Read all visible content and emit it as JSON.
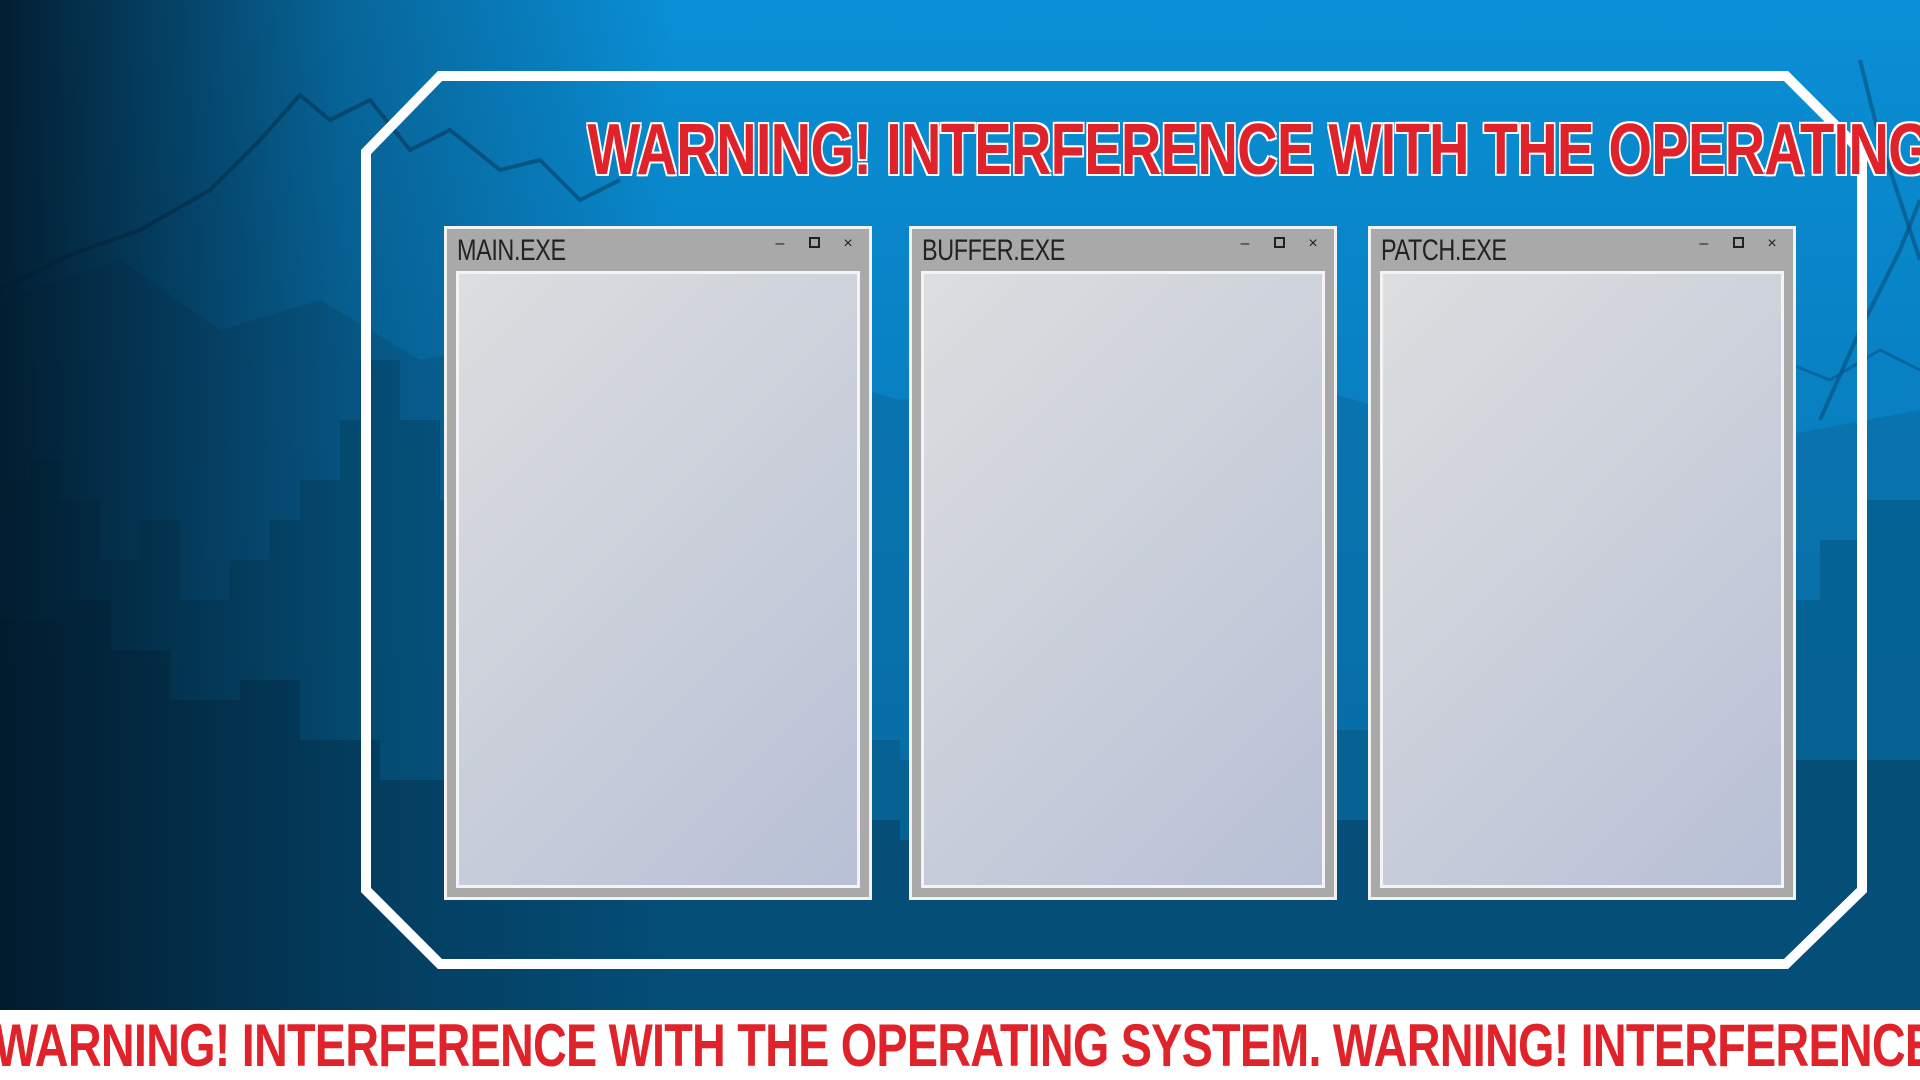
{
  "headline": "WARNING! INTERFERENCE WITH THE OPERATING SYSTEM",
  "windows": [
    {
      "title": "MAIN.EXE",
      "controls": {
        "minimize": "–",
        "maximize": "□",
        "close": "×"
      }
    },
    {
      "title": "BUFFER.EXE",
      "controls": {
        "minimize": "–",
        "maximize": "□",
        "close": "×"
      }
    },
    {
      "title": "PATCH.EXE",
      "controls": {
        "minimize": "–",
        "maximize": "□",
        "close": "×"
      }
    }
  ],
  "ticker": "WARNING! INTERFERENCE WITH THE OPERATING SYSTEM. WARNING! INTERFERENCE WITH THE OPERATING SYSTEM.",
  "colors": {
    "background_top": "#0a8fd6",
    "background_bottom": "#0a3e63",
    "warning_red": "#e0232a",
    "frame_white": "#ffffff",
    "window_gray": "#a9a9a9"
  },
  "icons": [
    "minimize-icon",
    "maximize-icon",
    "close-icon"
  ]
}
